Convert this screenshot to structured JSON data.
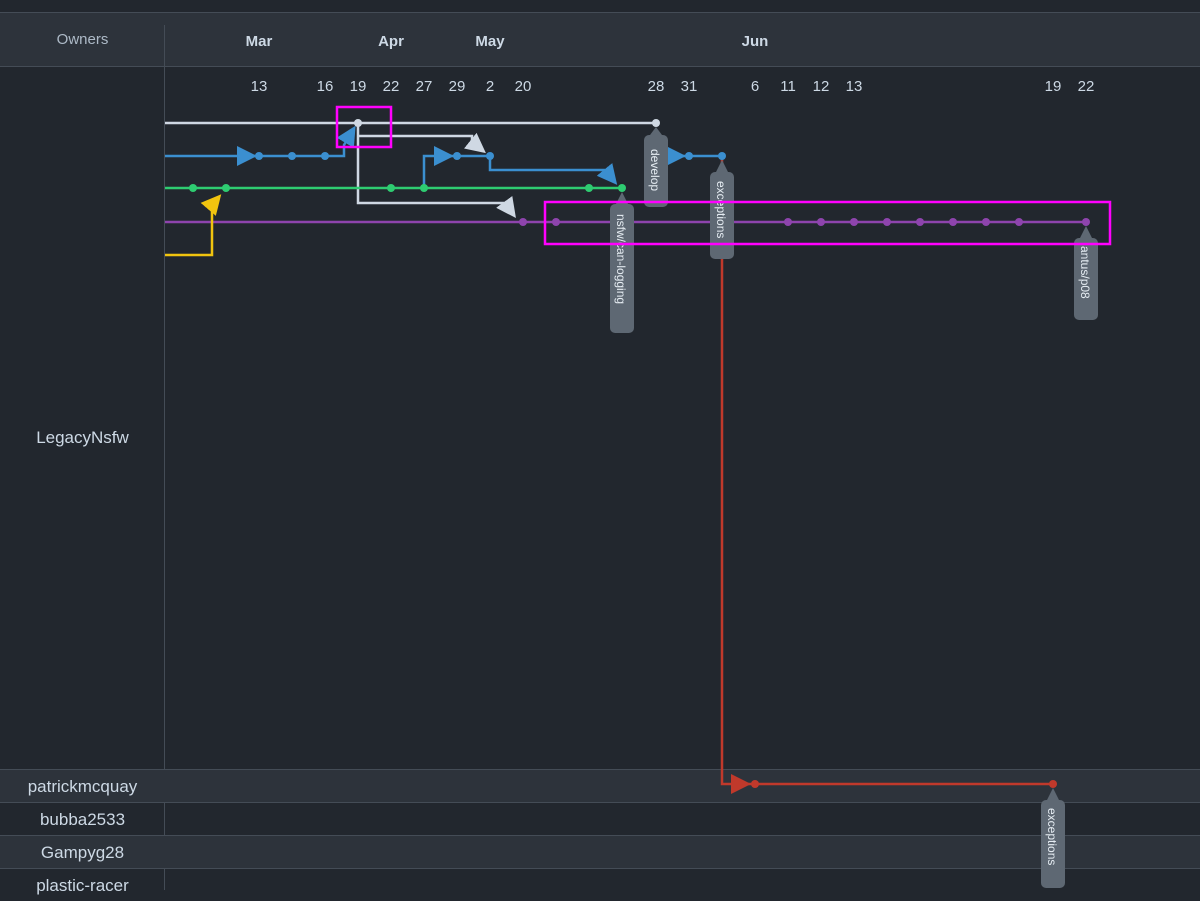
{
  "owners_header": "Owners",
  "months": [
    {
      "label": "Mar"
    },
    {
      "label": "Apr"
    },
    {
      "label": "May"
    },
    {
      "label": "Jun"
    }
  ],
  "days": [
    "13",
    "16",
    "19",
    "22",
    "27",
    "29",
    "2",
    "20",
    "28",
    "31",
    "6",
    "11",
    "12",
    "13",
    "19",
    "22"
  ],
  "owners": [
    {
      "name": "LegacyNsfw"
    },
    {
      "name": "patrickmcquay"
    },
    {
      "name": "bubba2533"
    },
    {
      "name": "Gampyg28"
    },
    {
      "name": "plastic-racer"
    }
  ],
  "branch_tags": [
    {
      "label": "develop"
    },
    {
      "label": "exceptions"
    },
    {
      "label": "nsfw/can-logging"
    },
    {
      "label": "antus/p08"
    },
    {
      "label": "exceptions"
    }
  ],
  "colors": {
    "background": "#22272e",
    "header": "#2d333b",
    "white_branch": "#cfd8e3",
    "blue_branch": "#3b8fd0",
    "green_branch": "#2ecc71",
    "purple_branch": "#8e44ad",
    "yellow_branch": "#f1c40f",
    "red_branch": "#c0392b",
    "highlight": "#ff00ff",
    "tag": "#5e6873"
  }
}
